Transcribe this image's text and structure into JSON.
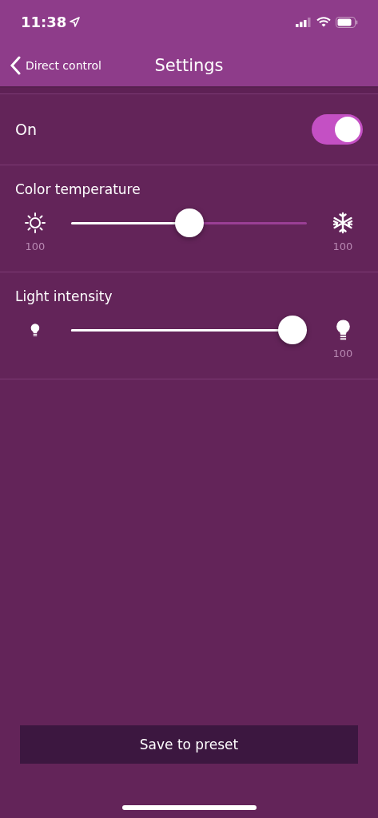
{
  "status_bar": {
    "time": "11:38"
  },
  "nav": {
    "back": "Direct control",
    "title": "Settings"
  },
  "power": {
    "label": "On",
    "on": true
  },
  "sliders": [
    {
      "kind": "temperature",
      "label": "Color temperature",
      "level": 0.5,
      "left_reading": "100",
      "right_reading": "100"
    },
    {
      "kind": "intensity",
      "label": "Light intensity",
      "level": 0.94,
      "right_reading": "100"
    }
  ],
  "save_button": "Save to preset"
}
